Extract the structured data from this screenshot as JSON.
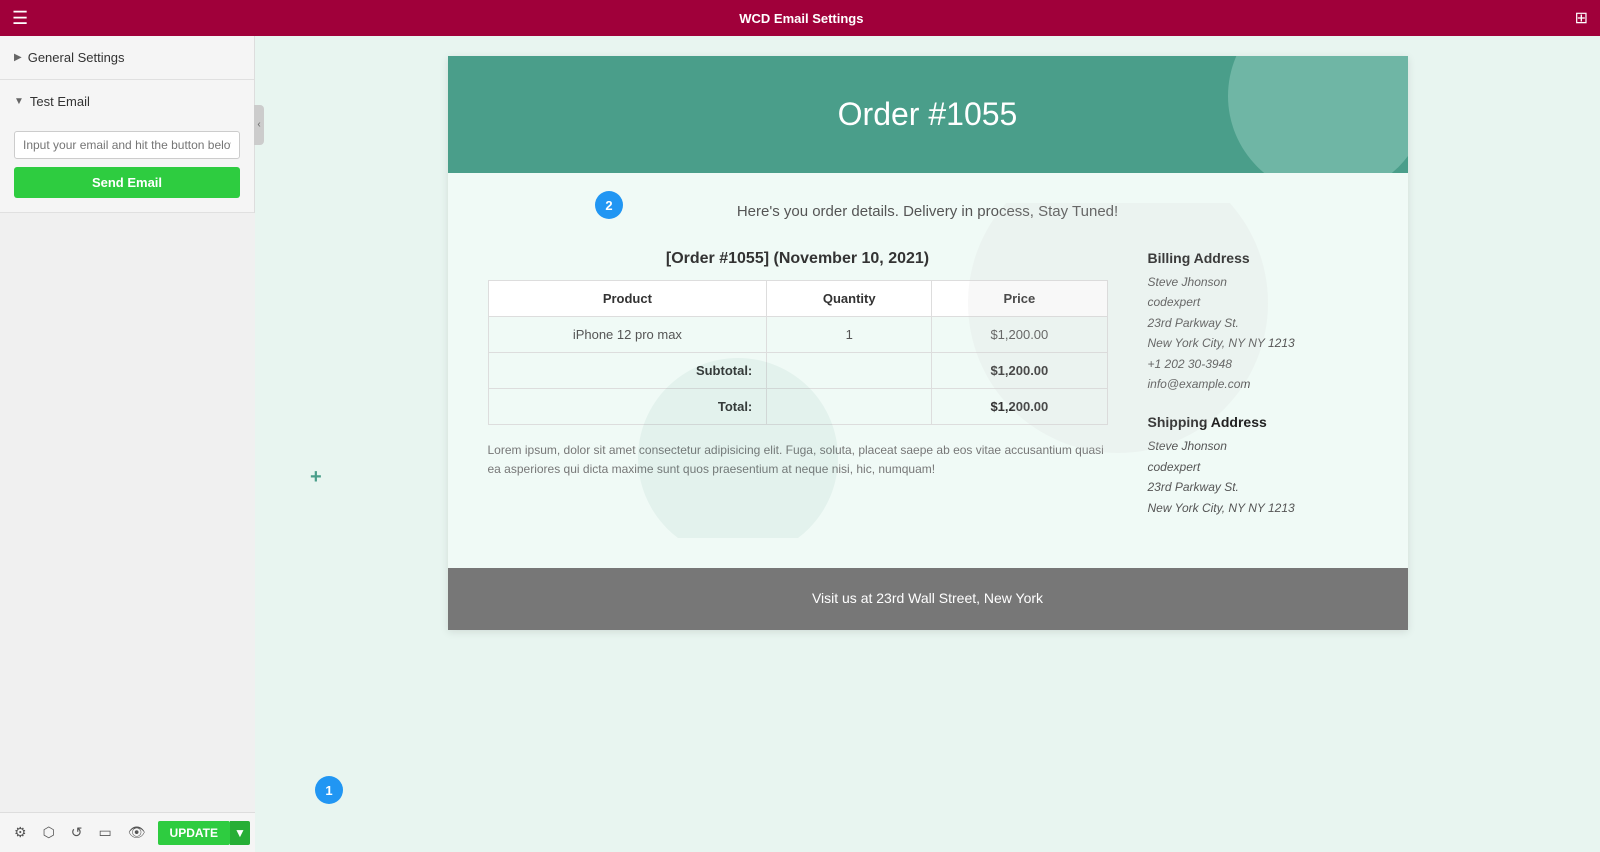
{
  "topbar": {
    "title": "WCD Email Settings",
    "hamburger_icon": "☰",
    "grid_icon": "⊞"
  },
  "sidebar": {
    "general_settings": {
      "label": "General Settings",
      "expanded": false
    },
    "test_email": {
      "label": "Test Email",
      "expanded": true,
      "input_placeholder": "Input your email and hit the button below",
      "send_button_label": "Send Email"
    }
  },
  "email_preview": {
    "header": {
      "title": "Order #1055"
    },
    "subtitle": "Here's you order details. Delivery in process, Stay Tuned!",
    "order": {
      "table_title": "[Order #1055] (November 10, 2021)",
      "columns": [
        "Product",
        "Quantity",
        "Price"
      ],
      "rows": [
        {
          "product": "iPhone 12 pro max",
          "quantity": "1",
          "price": "$1,200.00"
        }
      ],
      "subtotal_label": "Subtotal:",
      "subtotal_value": "$1,200.00",
      "total_label": "Total:",
      "total_value": "$1,200.00"
    },
    "lorem_text": "Lorem ipsum, dolor sit amet consectetur adipisicing elit. Fuga, soluta, placeat saepe ab eos vitae accusantium quasi ea asperiores qui dicta maxime sunt quos praesentium at neque nisi, hic, numquam!",
    "billing_address": {
      "title": "Billing Address",
      "name": "Steve Jhonson",
      "company": "codexpert",
      "street": "23rd Parkway St.",
      "city": "New York City, NY NY 1213",
      "phone": "+1 202 30-3948",
      "email": "info@example.com"
    },
    "shipping_address": {
      "title": "Shipping Address",
      "name": "Steve Jhonson",
      "company": "codexpert",
      "street": "23rd Parkway St.",
      "city": "New York City, NY NY 1213"
    },
    "footer": {
      "text": "Visit us at 23rd Wall Street, New York"
    }
  },
  "bottom_toolbar": {
    "update_label": "UPDATE"
  },
  "annotations": {
    "circle1": "1",
    "circle2": "2"
  }
}
